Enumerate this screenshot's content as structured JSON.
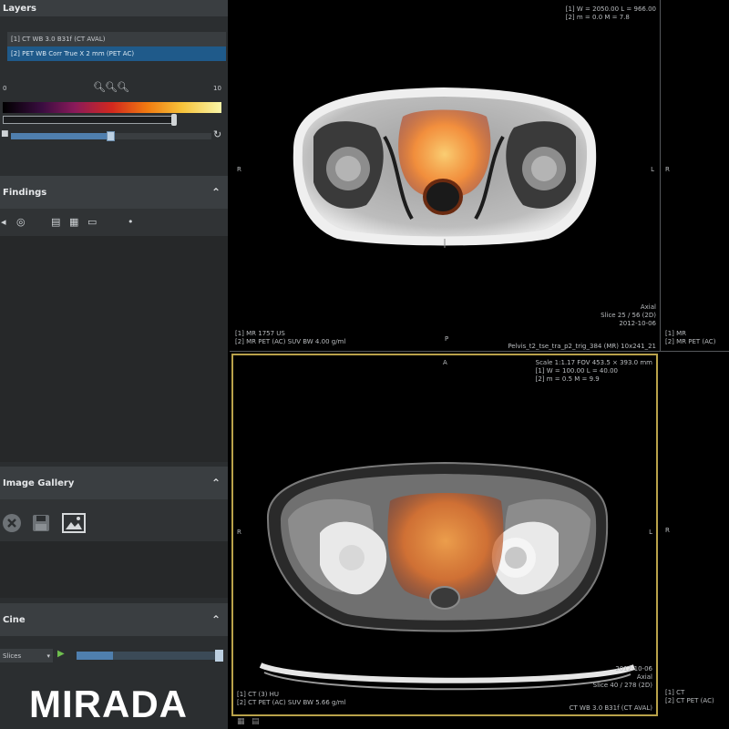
{
  "layers": {
    "title": "Layers",
    "items": [
      {
        "label": "[1] CT WB 3.0 B31f (CT AVAL)",
        "selected": false
      },
      {
        "label": "[2] PET WB Corr True X 2 mm (PET AC)",
        "selected": true
      }
    ],
    "lut_min": "0",
    "lut_max": "10",
    "opacity_percent": 50
  },
  "findings": {
    "title": "Findings"
  },
  "gallery": {
    "title": "Image Gallery"
  },
  "cine": {
    "title": "Cine",
    "mode": "Slices"
  },
  "logo": "MIRADA",
  "viewports": {
    "top": {
      "top_right": [
        "[1] W = 2050.00  L = 966.00",
        "[2] m = 0.0      M = 7.8"
      ],
      "left_marker": "R",
      "right_marker": "L",
      "bottom_marker": "P",
      "bottom_right": [
        "Axial",
        "Slice 25 / 56  (2D)",
        "2012-10-06"
      ],
      "bottom_left": [
        "[1] MR                  1757 US",
        "[2] MR PET (AC)      SUV BW  4.00 g/ml"
      ],
      "bottom_series": "Pelvis_t2_tse_tra_p2_trig_384 (MR) 10x241_21"
    },
    "top_right_partial": {
      "left_marker": "R",
      "bottom_left": [
        "[1] MR",
        "[2] MR PET (AC)"
      ]
    },
    "bottom": {
      "top_marker": "A",
      "top_right": [
        "Scale 1:1.17   FOV 453.5 × 393.0 mm",
        "[1] W = 100.00  L = 40.00",
        "[2] m = 0.5      M = 9.9"
      ],
      "left_marker": "R",
      "right_marker": "L",
      "bottom_right": [
        "2012-10-06",
        "Axial",
        "Slice 40 / 278  (2D)"
      ],
      "bottom_left": [
        "[1] CT                    (3) HU",
        "[2] CT PET (AC)      SUV BW  5.66 g/ml"
      ],
      "bottom_series": "CT WB 3.0 B31f (CT AVAL)"
    },
    "bottom_right_partial": {
      "left_marker": "R",
      "bottom_left": [
        "[1] CT",
        "[2] CT PET (AC)"
      ]
    }
  }
}
